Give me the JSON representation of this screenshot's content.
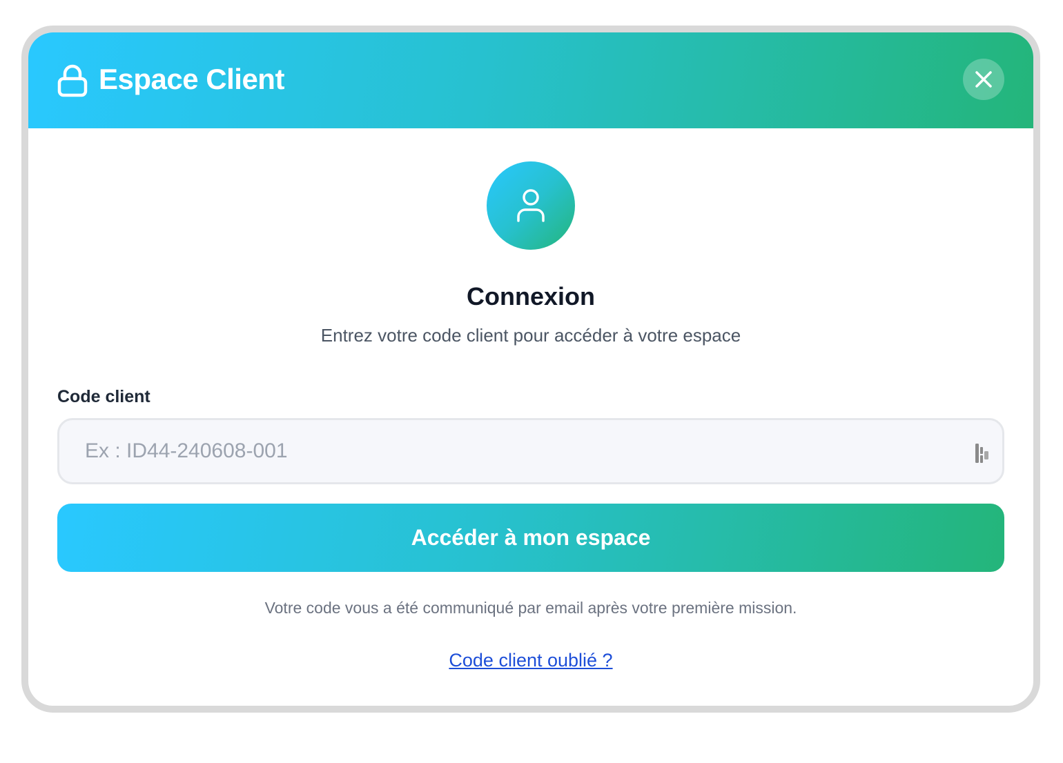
{
  "modal": {
    "title": "Espace Client",
    "lock_icon": "lock-icon",
    "close_icon": "close-icon"
  },
  "login": {
    "avatar_icon": "user-icon",
    "title": "Connexion",
    "subtitle": "Entrez votre code client pour accéder à votre espace"
  },
  "form": {
    "code_label": "Code client",
    "code_value": "",
    "code_placeholder": "Ex : ID44-240608-001",
    "autofill_icon": "password-manager-icon",
    "submit_label": "Accéder à mon espace"
  },
  "footer": {
    "help_text": "Votre code vous a été communiqué par email après votre première mission.",
    "forgot_link": "Code client oublié ?"
  },
  "colors": {
    "gradient_start": "#29c8ff",
    "gradient_end": "#24b57a",
    "title_text": "#111827",
    "link": "#1d4ed8",
    "frame_border": "#d9d9d9"
  }
}
